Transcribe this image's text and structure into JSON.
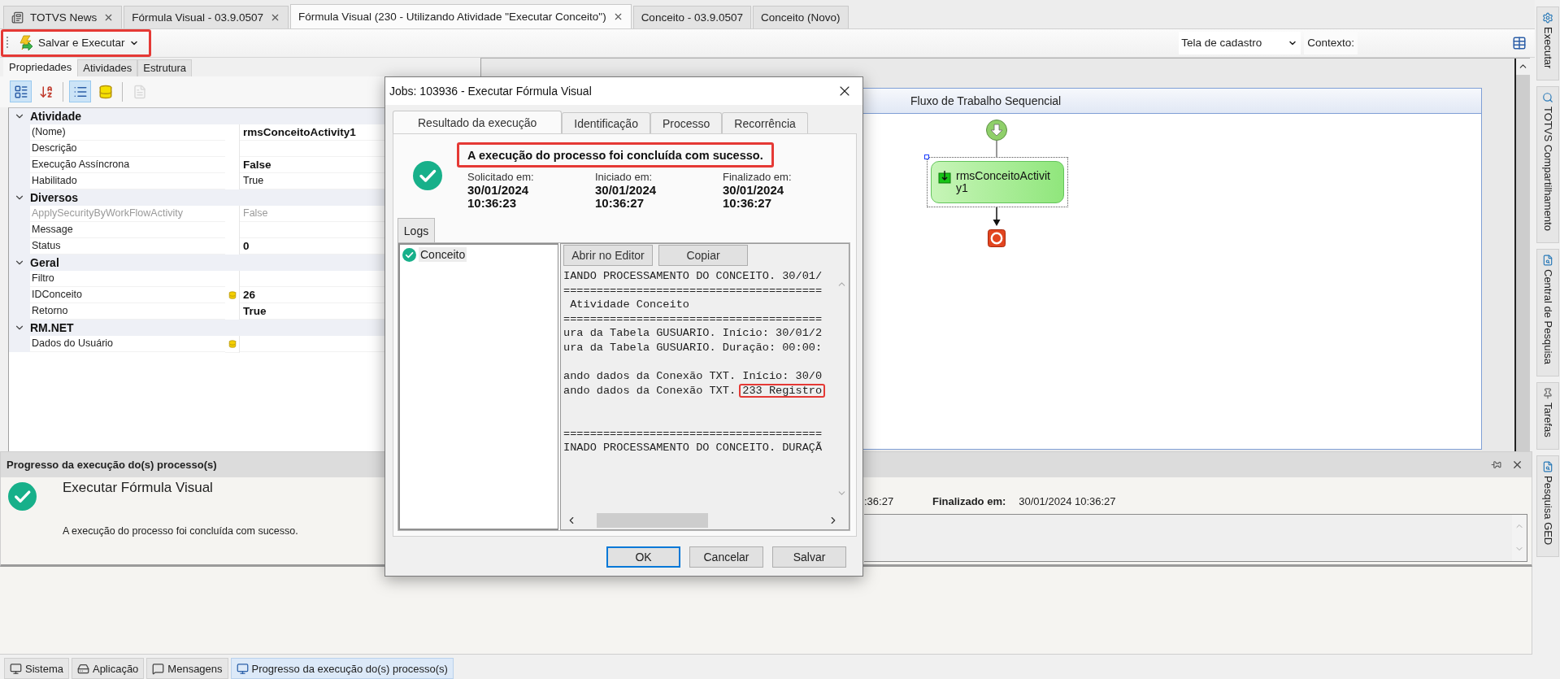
{
  "doc_tabs": [
    {
      "label": "TOTVS News",
      "kind": "news",
      "selected": false,
      "closable": true
    },
    {
      "label": "Fórmula Visual - 03.9.0507",
      "kind": "document",
      "selected": false,
      "closable": true
    },
    {
      "label": "Fórmula Visual (230 - Utilizando Atividade \"Executar Conceito\")",
      "kind": "document",
      "selected": true,
      "closable": true
    },
    {
      "label": "Conceito - 03.9.0507",
      "kind": "document",
      "selected": false,
      "closable": false
    },
    {
      "label": "Conceito (Novo)",
      "kind": "document",
      "selected": false,
      "closable": false
    }
  ],
  "toolbar": {
    "action": "Salvar e Executar",
    "highlighted": true,
    "view": "Tela de cadastro",
    "context_label": "Contexto:"
  },
  "panel_tabs": [
    {
      "label": "Propriedades",
      "selected": true
    },
    {
      "label": "Atividades",
      "selected": false
    },
    {
      "label": "Estrutura",
      "selected": false
    }
  ],
  "grid_tools": [
    {
      "kind": "categorized",
      "selected": true,
      "disabled": false
    },
    {
      "kind": "alphabetical",
      "selected": false,
      "disabled": false
    },
    {
      "kind": "properties",
      "selected": true,
      "disabled": false
    },
    {
      "kind": "database",
      "selected": false,
      "disabled": false
    },
    {
      "kind": "pages",
      "selected": false,
      "disabled": true
    }
  ],
  "property_grid": [
    {
      "category": "Atividade",
      "expanded": true,
      "rows": [
        {
          "name": "(Nome)",
          "value": "rmsConceitoActivity1",
          "bold": true,
          "disabled": false,
          "bound": false
        },
        {
          "name": "Descrição",
          "disabled": false,
          "bound": false
        },
        {
          "name": "Execução Assíncrona",
          "value": "False",
          "bold": true,
          "disabled": false,
          "bound": false
        },
        {
          "name": "Habilitado",
          "value": "True",
          "bold": false,
          "disabled": false,
          "bound": false
        }
      ]
    },
    {
      "category": "Diversos",
      "expanded": true,
      "rows": [
        {
          "name": "ApplySecurityByWorkFlowActivity",
          "value": "False",
          "bold": false,
          "disabled": true,
          "bound": false
        },
        {
          "name": "Message",
          "disabled": false,
          "bound": false
        },
        {
          "name": "Status",
          "value": "0",
          "bold": true,
          "disabled": false,
          "bound": false
        }
      ]
    },
    {
      "category": "Geral",
      "expanded": true,
      "rows": [
        {
          "name": "Filtro",
          "disabled": false,
          "bound": false
        },
        {
          "name": "IDConceito",
          "value": "26",
          "bold": true,
          "disabled": false,
          "bound": true
        },
        {
          "name": "Retorno",
          "value": "True",
          "bold": true,
          "disabled": false,
          "bound": false
        }
      ]
    },
    {
      "category": "RM.NET",
      "expanded": true,
      "rows": [
        {
          "name": "Dados do Usuário",
          "disabled": false,
          "bound": true
        }
      ]
    }
  ],
  "designer": {
    "title": "Fluxo de Trabalho Sequencial",
    "activity": "rmsConceitoActivity1",
    "activity_selected": true
  },
  "progress_panel": {
    "title": "Progresso da execução do(s) processo(s)",
    "job": "Executar Fórmula Visual",
    "kind": "success",
    "message": "A execução do processo foi concluída com sucesso.",
    "started_tail": ":36:27",
    "finished_label": "Finalizado em:",
    "finished_value": "30/01/2024 10:36:27"
  },
  "bottom_tabs": [
    {
      "label": "Sistema",
      "kind": "system",
      "selected": false
    },
    {
      "label": "Aplicação",
      "kind": "app",
      "selected": false
    },
    {
      "label": "Mensagens",
      "kind": "messages",
      "selected": false
    },
    {
      "label": "Progresso da execução do(s) processo(s)",
      "kind": "progress",
      "selected": true
    }
  ],
  "side_tabs": [
    {
      "label": "Executar",
      "kind": "gear"
    },
    {
      "label": "TOTVS Compartilhamento",
      "kind": "search"
    },
    {
      "label": "Central de Pesquisa",
      "kind": "doc"
    },
    {
      "label": "Tarefas",
      "kind": "pin"
    },
    {
      "label": "Pesquisa GED",
      "kind": "doc"
    }
  ],
  "dialog": {
    "title": "Jobs: 103936 - Executar Fórmula Visual",
    "tabs": [
      {
        "label": "Resultado da execução",
        "selected": true
      },
      {
        "label": "Identificação",
        "selected": false
      },
      {
        "label": "Processo",
        "selected": false
      },
      {
        "label": "Recorrência",
        "selected": false
      }
    ],
    "kind": "success",
    "message": "A execução do processo foi concluída com sucesso.",
    "message_highlighted": true,
    "times": [
      {
        "label": "Solicitado em:",
        "date": "30/01/2024",
        "time": "10:36:23"
      },
      {
        "label": "Iniciado em:",
        "date": "30/01/2024",
        "time": "10:36:27"
      },
      {
        "label": "Finalizado em:",
        "date": "30/01/2024",
        "time": "10:36:27"
      }
    ],
    "logs_tab": "Logs",
    "log_tree": [
      {
        "label": "Conceito",
        "kind": "success"
      }
    ],
    "log_buttons": [
      "Abrir no Editor",
      "Copiar"
    ],
    "log_lines": [
      {
        "kind": "text",
        "text": "IANDO PROCESSAMENTO DO CONCEITO. 30/01/"
      },
      {
        "kind": "text",
        "text": "======================================="
      },
      {
        "kind": "text",
        "text": " Atividade Conceito"
      },
      {
        "kind": "text",
        "text": "======================================="
      },
      {
        "kind": "text",
        "text": "ura da Tabela GUSUARIO. Início: 30/01/2"
      },
      {
        "kind": "text",
        "text": "ura da Tabela GUSUARIO. Duração: 00:00:"
      },
      {
        "kind": "blank"
      },
      {
        "kind": "text",
        "text": "ando dados da Conexão TXT. Início: 30/0"
      },
      {
        "kind": "text",
        "text": "ando dados da Conexão TXT. ",
        "highlight": "233 Registro"
      },
      {
        "kind": "blank"
      },
      {
        "kind": "blank"
      },
      {
        "kind": "text",
        "text": "======================================="
      },
      {
        "kind": "text",
        "text": "INADO PROCESSAMENTO DO CONCEITO. DURAÇÃ"
      }
    ],
    "buttons": [
      {
        "label": "OK",
        "default": true
      },
      {
        "label": "Cancelar",
        "default": false
      },
      {
        "label": "Salvar",
        "default": false
      }
    ]
  }
}
